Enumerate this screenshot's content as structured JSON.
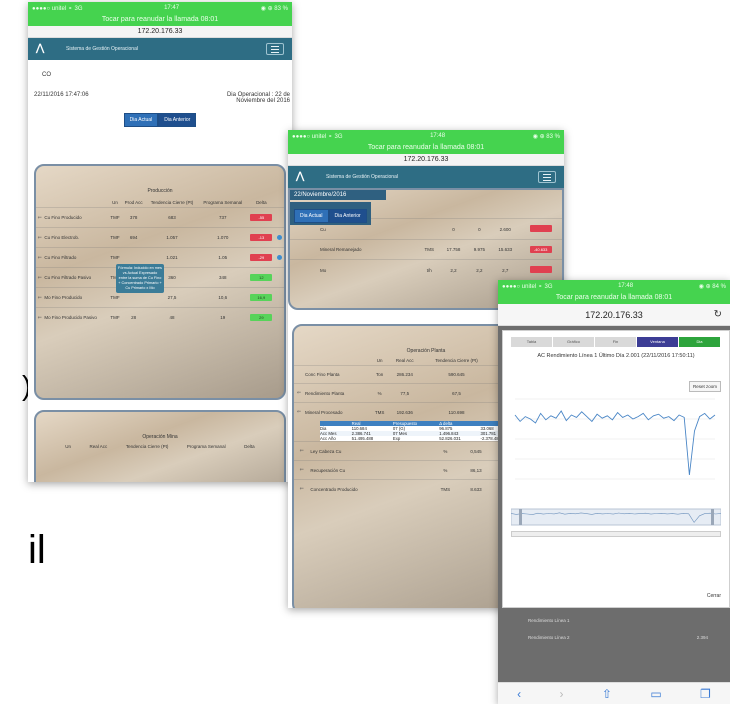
{
  "phone1": {
    "status_left": "●●●●○ unitel ⚬ 3G",
    "status_time": "17:47",
    "status_right": "◉ ⊕ 83 %",
    "call_bar": "Tocar para reanudar la llamada 08:01",
    "url": "172.20.176.33",
    "nav_title": "Sistema de Gestión Operacional",
    "section_label": "CO",
    "datetime": "22/11/2016 17:47:06",
    "operational_day_label": "Dia Operacional : 22 de",
    "operational_day_label2": "Noviembre del 2016",
    "btn_today": "Dia Actual",
    "btn_previous": "Dia Anterior",
    "panel_title": "Producción",
    "columns": [
      "",
      "Un",
      "Prod Acc",
      "Tendencia Cierre (Pt)",
      "Programa Semanal",
      "Delta"
    ],
    "rows": [
      {
        "label": "Cu Fino Producido",
        "un": "TMF",
        "acc": "378",
        "trend": "683",
        "prog": "737",
        "delta": "-55",
        "status": "red"
      },
      {
        "label": "Cu Fino Electrob.",
        "un": "TMF",
        "acc": "694",
        "trend": "1.057",
        "prog": "1.070",
        "delta": "-13",
        "status": "red"
      },
      {
        "label": "Cu Fino Filtrado",
        "un": "TMF",
        "acc": "",
        "trend": "1.021",
        "prog": "1.05",
        "delta": "-29",
        "status": "red"
      },
      {
        "label": "Cu Fino Filtrado Pasivo",
        "un": "TMF",
        "acc": "",
        "trend": "360",
        "prog": "348",
        "delta": "12",
        "status": "green"
      },
      {
        "label": "Mo Fino Producido",
        "un": "TMF",
        "acc": "",
        "trend": "27,5",
        "prog": "10,6",
        "delta": "16,9",
        "status": "green"
      },
      {
        "label": "Mo Fino Producido Pasivo",
        "un": "TMF",
        "acc": "28",
        "trend": "48",
        "prog": "19",
        "delta": "29",
        "status": "green"
      }
    ],
    "tooltip": "Fórmula: Inducido en mes vs Actual Expresado entre la suma de Cu Fino + Concentrado Primario + Cu Primario x Mo",
    "panel2_title": "Operación Mina",
    "panel2_columns": [
      "",
      "Un",
      "Real Acc",
      "Tendencia Cierre (Pt)",
      "Programa Semanal",
      "Delta"
    ]
  },
  "phone2": {
    "status_left": "●●●●○ unitel ⚬ 3G",
    "status_time": "17:48",
    "status_right": "◉ ⊕ 83 %",
    "call_bar": "Tocar para reanudar la llamada 08:01",
    "url": "172.20.176.33",
    "nav_title": "Sistema de Gestión Operacional",
    "date_header": "22/Noviembre/2016",
    "btn_today": "Dia Actual",
    "btn_previous": "Dia Anterior",
    "top_rows": [
      {
        "label": "Cu",
        "un": "",
        "acc": "0",
        "trend": "0",
        "prog": "2.600",
        "delta": "",
        "status": "red"
      },
      {
        "label": "Mineral Remanejado",
        "un": "TMS",
        "acc": "17.758",
        "trend": "9.975",
        "prog": "15.633",
        "delta": "-40.633",
        "status": "red"
      },
      {
        "label": "Mo",
        "un": "t/h",
        "acc": "2,2",
        "trend": "2,2",
        "prog": "2,7",
        "delta": "",
        "status": "red"
      }
    ],
    "panel_title": "Operación Planta",
    "columns": [
      "",
      "Un",
      "Real Acc",
      "Tendencia Cierre (Pt)",
      "Programa Semanal",
      "Delta"
    ],
    "rows": [
      {
        "label": "Conc Fino Planta",
        "un": "Ton",
        "acc": "286.234",
        "trend": "590.645",
        "prog": "672.306",
        "delta": ""
      },
      {
        "label": "Rendimiento Planta",
        "un": "%",
        "acc": "77,5",
        "trend": "67,5",
        "prog": "91,7",
        "delta": ""
      },
      {
        "label": "Mineral Procesado",
        "un": "TMS",
        "acc": "192.636",
        "trend": "110.698",
        "prog": "112.883",
        "delta": ""
      }
    ],
    "popup_columns": [
      "",
      "Real",
      "Presupuesto",
      "Δ delta",
      ""
    ],
    "popup_rows": [
      [
        "Dia",
        "110.684",
        "07 (G)",
        "96.875",
        "33.068"
      ],
      [
        "Acc Mes",
        "2.386.741",
        "07 Mes",
        "1.496.843",
        "301.781"
      ],
      [
        "Acc Año",
        "51.495.488",
        "Exp",
        "52.826.031",
        "-2.378.481"
      ]
    ],
    "rows2": [
      {
        "label": "Ley Cabeza Cu",
        "un": "%",
        "acc": "0,545",
        "trend": "0,661",
        "prog": "0,706",
        "delta": ""
      },
      {
        "label": "Recuperación Cu",
        "un": "%",
        "acc": "86,13",
        "trend": "88,14",
        "prog": "88,73",
        "delta": ""
      },
      {
        "label": "Concentrado Producido",
        "un": "TMS",
        "acc": "8.633",
        "trend": "7.014",
        "prog": "6.475",
        "delta": ""
      }
    ]
  },
  "phone3": {
    "status_left": "●●●●○ unitel ⚬ 3G",
    "status_time": "17:48",
    "status_right": "◉ ⊕ 84 %",
    "call_bar": "Tocar para reanudar la llamada 08:01",
    "url": "172.20.176.33",
    "tabs": [
      "Tabla",
      "Gráfico",
      "Fin",
      "Ventana",
      "Dia"
    ],
    "chart_title": "AC Rendimiento Línea 1 Último Día 2.001 (22/11/2016 17:50:11)",
    "reset_zoom": "Reset zoom",
    "x_ticks": [
      "",
      "",
      "",
      "",
      "",
      "",
      "",
      ""
    ],
    "close_label": "Cerrar",
    "below_rows": [
      "Rendimiento Línea 1",
      "Rendimiento Línea 2"
    ],
    "below_values": [
      "",
      "2.394"
    ]
  },
  "side_text": "il",
  "chart_data": {
    "type": "line",
    "title": "AC Rendimiento Línea 1 Último Día 2.001 (22/11/2016 17:50:11)",
    "xlabel": "",
    "ylabel": "",
    "ylim": [
      0,
      100
    ],
    "series": [
      {
        "values": [
          80,
          72,
          78,
          75,
          70,
          82,
          74,
          79,
          76,
          85,
          73,
          80,
          77,
          84,
          78,
          72,
          81,
          76,
          79,
          74,
          83,
          77,
          80,
          75,
          78,
          82,
          74,
          79,
          81,
          76,
          78,
          73,
          80,
          77,
          5,
          60,
          78,
          82,
          75,
          80
        ]
      }
    ],
    "grid": true
  }
}
